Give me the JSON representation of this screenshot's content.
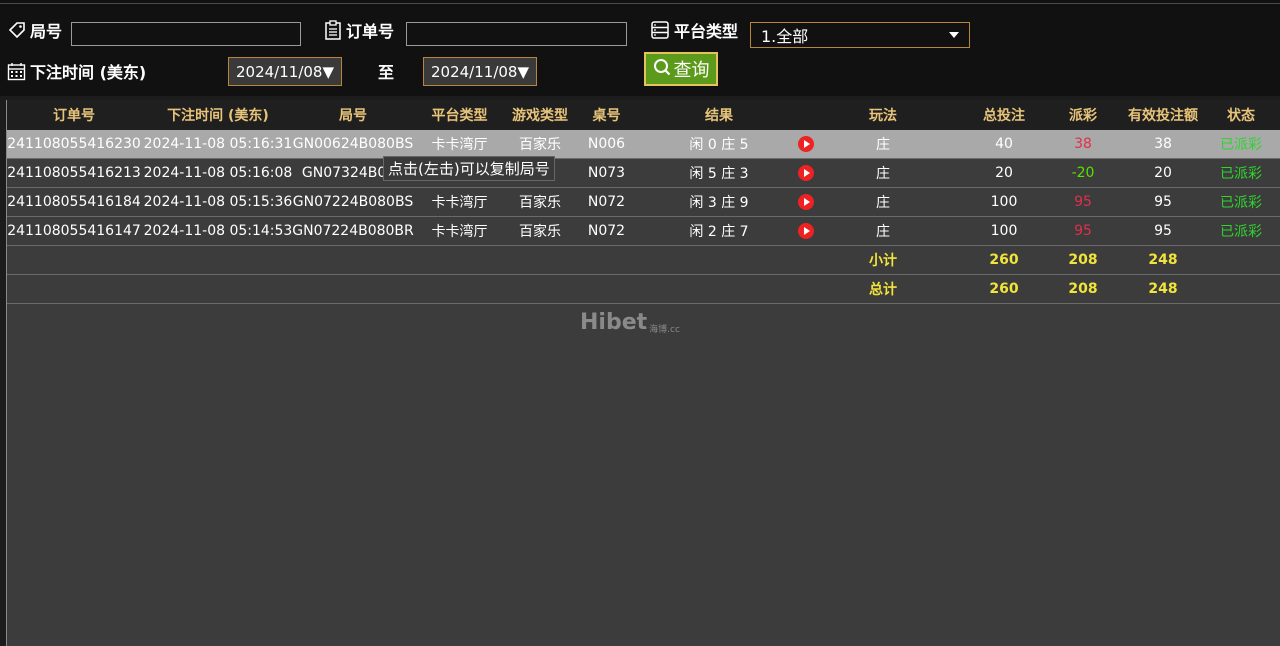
{
  "filters": {
    "round_no_label": "局号",
    "order_no_label": "订单号",
    "platform_type_label": "平台类型",
    "platform_type_value": "1.全部",
    "bet_time_label": "下注时间 (美东)",
    "date_from": "2024/11/08▼",
    "to_label": "至",
    "date_to": "2024/11/08▼",
    "query_label": "查询"
  },
  "table": {
    "headers": [
      "订单号",
      "下注时间 (美东)",
      "局号",
      "平台类型",
      "游戏类型",
      "桌号",
      "结果",
      "",
      "玩法",
      "总投注",
      "派彩",
      "有效投注额",
      "状态"
    ],
    "rows": [
      {
        "order": "241108055416230",
        "time": "2024-11-08 05:16:31",
        "round": "GN00624B080BS",
        "platform": "卡卡湾厅",
        "game": "百家乐",
        "table": "N006",
        "result": "闲 0 庄 5",
        "play": "庄",
        "bet": "40",
        "payout": "38",
        "valid": "38",
        "status": "已派彩"
      },
      {
        "order": "241108055416213",
        "time": "2024-11-08 05:16:08",
        "round": "GN07324B080",
        "platform": "",
        "game": "",
        "table": "N073",
        "result": "闲 5 庄 3",
        "play": "庄",
        "bet": "20",
        "payout": "-20",
        "valid": "20",
        "status": "已派彩"
      },
      {
        "order": "241108055416184",
        "time": "2024-11-08 05:15:36",
        "round": "GN07224B080BS",
        "platform": "卡卡湾厅",
        "game": "百家乐",
        "table": "N072",
        "result": "闲 3 庄 9",
        "play": "庄",
        "bet": "100",
        "payout": "95",
        "valid": "95",
        "status": "已派彩"
      },
      {
        "order": "241108055416147",
        "time": "2024-11-08 05:14:53",
        "round": "GN07224B080BR",
        "platform": "卡卡湾厅",
        "game": "百家乐",
        "table": "N072",
        "result": "闲 2 庄 7",
        "play": "庄",
        "bet": "100",
        "payout": "95",
        "valid": "95",
        "status": "已派彩"
      }
    ],
    "subtotal": {
      "label": "小计",
      "bet": "260",
      "payout": "208",
      "valid": "248"
    },
    "total": {
      "label": "总计",
      "bet": "260",
      "payout": "208",
      "valid": "248"
    }
  },
  "tooltip": "点击(左击)可以复制局号",
  "watermark": {
    "main": "Hibet",
    "sub": "海博.cc"
  },
  "colors": {
    "header_text": "#e8c47a",
    "sum_text": "#f1e43a",
    "status_green": "#2fd42f",
    "payout_positive": "#e0304a",
    "payout_negative": "#57e000",
    "highlight_row": "#a9a9a9",
    "query_button": "#5b9a1a"
  }
}
